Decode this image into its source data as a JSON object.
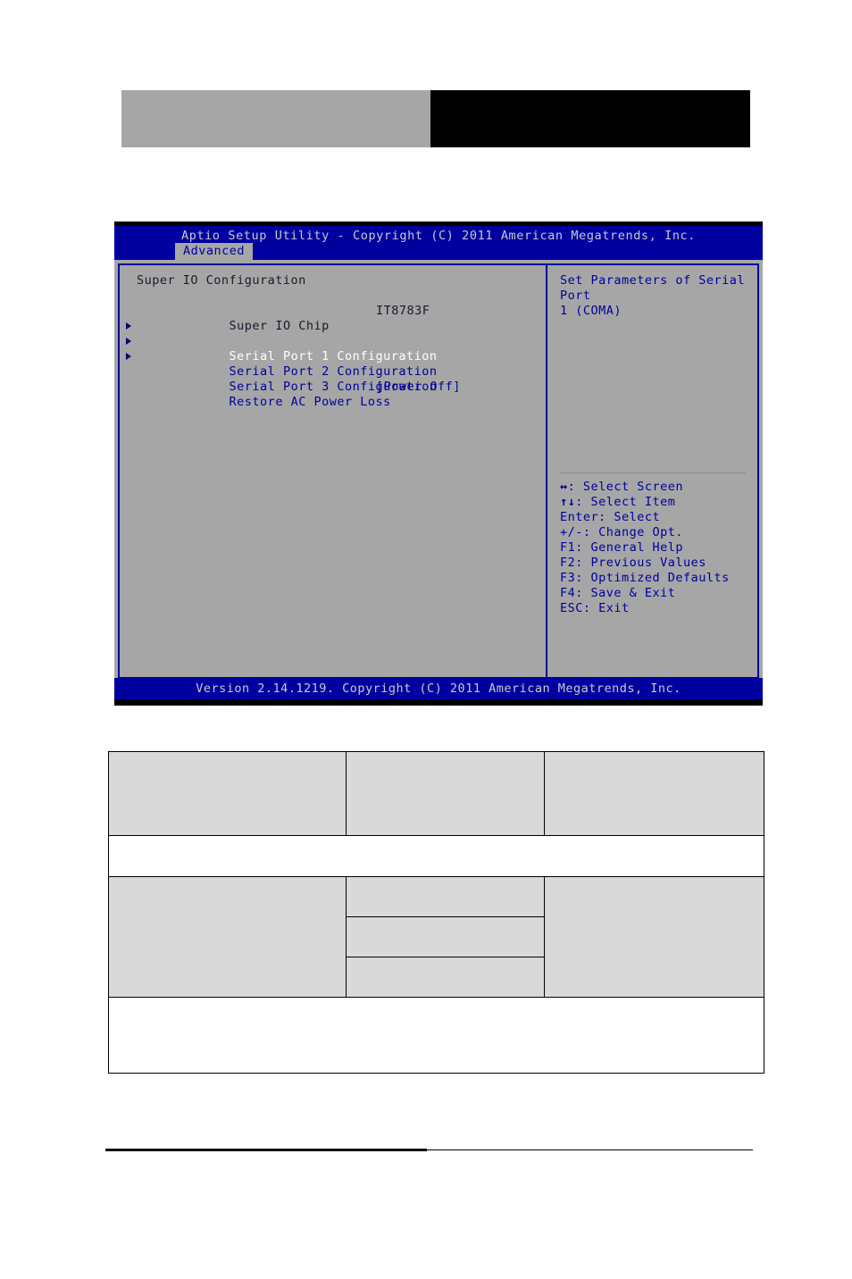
{
  "page": {
    "header_blocks": [
      {
        "name": "logo-block-left",
        "color": "#a6a6a6"
      },
      {
        "name": "logo-block-right",
        "color": "#000000"
      }
    ]
  },
  "bios": {
    "title": "Aptio Setup Utility - Copyright (C) 2011 American Megatrends, Inc.",
    "active_tab": "Advanced",
    "tabs": [
      "Advanced"
    ],
    "section_heading": "Super IO Configuration",
    "items": [
      {
        "label": "Super IO Chip",
        "value": "IT8783F",
        "style": "dark",
        "submenu": false
      },
      {
        "label": "Serial Port 1 Configuration",
        "value": "",
        "style": "selected",
        "submenu": true
      },
      {
        "label": "Serial Port 2 Configuration",
        "value": "",
        "style": "blue",
        "submenu": true
      },
      {
        "label": "Serial Port 3 Configuration",
        "value": "",
        "style": "blue",
        "submenu": true
      },
      {
        "label": "Restore AC Power Loss",
        "value": "[Power Off]",
        "style": "blue",
        "submenu": false
      }
    ],
    "help": {
      "line1": "Set Parameters of Serial Port",
      "line2": "1 (COMA)"
    },
    "hotkeys": [
      {
        "glyph": "↔",
        "text": ": Select Screen"
      },
      {
        "glyph": "↑↓",
        "text": ": Select Item"
      },
      {
        "glyph": "",
        "text": "Enter: Select"
      },
      {
        "glyph": "",
        "text": "+/-: Change Opt."
      },
      {
        "glyph": "",
        "text": "F1: General Help"
      },
      {
        "glyph": "",
        "text": "F2: Previous Values"
      },
      {
        "glyph": "",
        "text": "F3: Optimized Defaults"
      },
      {
        "glyph": "",
        "text": "F4: Save & Exit"
      },
      {
        "glyph": "",
        "text": "ESC: Exit"
      }
    ],
    "footer": "Version 2.14.1219. Copyright (C) 2011 American Megatrends, Inc.",
    "colors": {
      "screen_bg": "#0000a0",
      "panel_bg": "#a6a6a6",
      "accent_blue": "#0000a0",
      "selected_text": "#ffffff",
      "dark_text": "#1a1a2e",
      "title_text": "#c8c8c8"
    }
  },
  "doc_table": {
    "block1": {
      "cells": [
        "",
        "",
        ""
      ]
    },
    "block2": {
      "cells": [
        ""
      ]
    },
    "block3": {
      "left": "",
      "middle_rows": [
        "",
        "",
        ""
      ],
      "right": ""
    },
    "block4": {
      "cells": [
        ""
      ]
    }
  }
}
